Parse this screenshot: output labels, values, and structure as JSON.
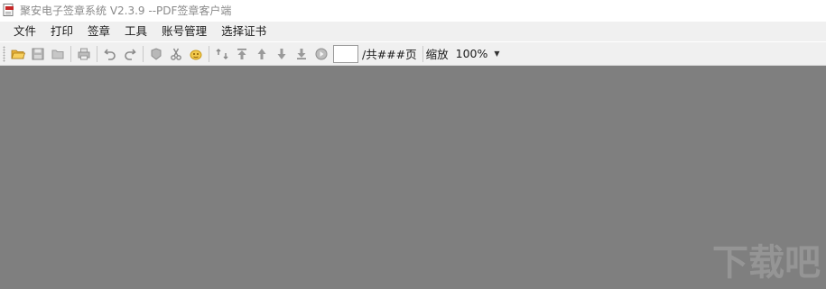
{
  "window": {
    "title": "聚安电子签章系统 V2.3.9 --PDF签章客户端"
  },
  "menu": [
    "文件",
    "打印",
    "签章",
    "工具",
    "账号管理",
    "选择证书"
  ],
  "toolbar": {
    "page_value": "",
    "total_pages": "/共###页",
    "zoom_label": "缩放",
    "zoom_value": "100%"
  },
  "watermark": {
    "text": "下载吧"
  },
  "icons": [
    "open-folder-icon",
    "save-icon",
    "folder-icon",
    "print-icon",
    "undo-icon",
    "redo-icon",
    "seal-icon",
    "cut-icon",
    "stamp-icon",
    "refresh-icon",
    "first-page-icon",
    "prev-page-icon",
    "next-page-icon",
    "last-page-icon",
    "goto-page-icon"
  ],
  "colors": {
    "canvas": "#7f7f7f",
    "toolbar": "#f0f0f0",
    "accent": "#f2b53a"
  }
}
